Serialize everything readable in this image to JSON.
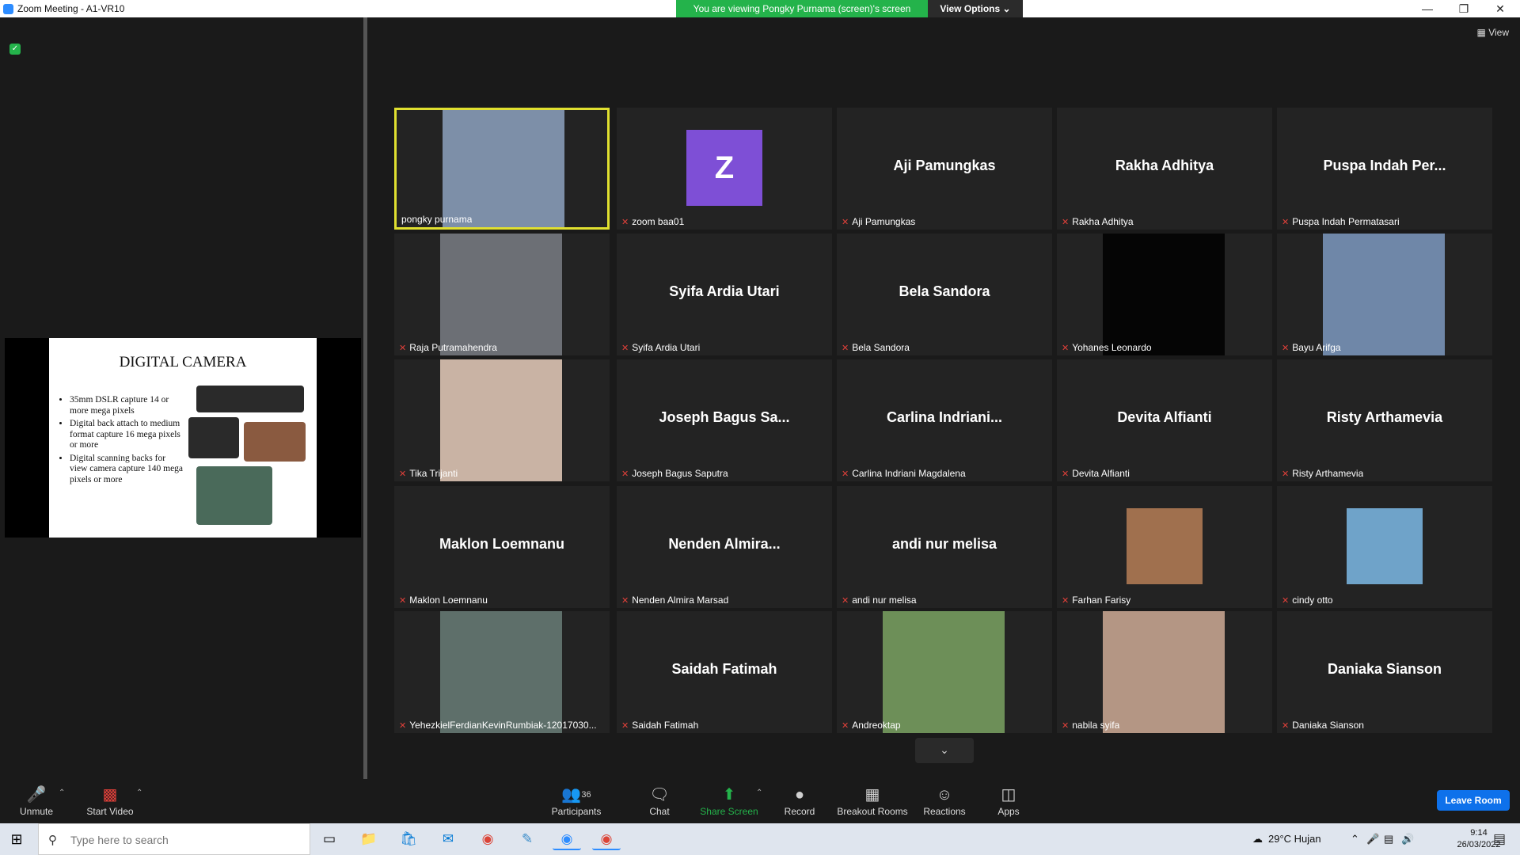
{
  "window": {
    "title": "Zoom Meeting - A1-VR10",
    "banner": "You are viewing Pongky Purnama (screen)'s screen",
    "view_options": "View Options",
    "view_button": "View"
  },
  "slide": {
    "title": "DIGITAL CAMERA",
    "bullets": [
      "35mm DSLR capture 14 or more mega pixels",
      "Digital back attach to medium format capture 16 mega pixels or more",
      "Digital scanning backs for view camera capture 140 mega pixels or more"
    ]
  },
  "participants": [
    {
      "label": "pongky purnama",
      "big": "",
      "type": "photo",
      "color": "#7d8fa8",
      "muted": false,
      "active": true
    },
    {
      "label": "zoom baa01",
      "big": "Z",
      "type": "avatar",
      "color": "#7e4fd6",
      "muted": true
    },
    {
      "label": "Aji Pamungkas",
      "big": "Aji Pamungkas",
      "type": "name",
      "muted": true
    },
    {
      "label": "Rakha Adhitya",
      "big": "Rakha Adhitya",
      "type": "name",
      "muted": true
    },
    {
      "label": "Puspa Indah Permatasari",
      "big": "Puspa Indah Per...",
      "type": "name",
      "muted": true
    },
    {
      "label": "Raja Putramahendra",
      "big": "",
      "type": "photo",
      "color": "#6c6f75",
      "muted": true
    },
    {
      "label": "Syifa Ardia Utari",
      "big": "Syifa Ardia Utari",
      "type": "name",
      "muted": true
    },
    {
      "label": "Bela Sandora",
      "big": "Bela Sandora",
      "type": "name",
      "muted": true
    },
    {
      "label": "Yohanes Leonardo",
      "big": "",
      "type": "photo",
      "color": "#050505",
      "muted": true
    },
    {
      "label": "Bayu Arifga",
      "big": "",
      "type": "photo",
      "color": "#6f87a8",
      "muted": true
    },
    {
      "label": "Tika Trijanti",
      "big": "",
      "type": "photo",
      "color": "#c9b3a4",
      "muted": true
    },
    {
      "label": "Joseph Bagus Saputra",
      "big": "Joseph Bagus Sa...",
      "type": "name",
      "muted": true
    },
    {
      "label": "Carlina Indriani Magdalena",
      "big": "Carlina  Indriani...",
      "type": "name",
      "muted": true
    },
    {
      "label": "Devita Alfianti",
      "big": "Devita Alfianti",
      "type": "name",
      "muted": true
    },
    {
      "label": "Risty Arthamevia",
      "big": "Risty Arthamevia",
      "type": "name",
      "muted": true
    },
    {
      "label": "Maklon Loemnanu",
      "big": "Maklon Loemnanu",
      "type": "name",
      "muted": true
    },
    {
      "label": "Nenden Almira Marsad",
      "big": "Nenden  Almira...",
      "type": "name",
      "muted": true
    },
    {
      "label": "andi nur melisa",
      "big": "andi nur melisa",
      "type": "name",
      "muted": true
    },
    {
      "label": "Farhan Farisy",
      "big": "",
      "type": "small-photo",
      "color": "#a0704e",
      "muted": true
    },
    {
      "label": "cindy otto",
      "big": "",
      "type": "small-photo",
      "color": "#6fa3c9",
      "muted": true
    },
    {
      "label": "YehezkielFerdianKevinRumbiak-12017030...",
      "big": "",
      "type": "photo",
      "color": "#5e6f6a",
      "muted": true
    },
    {
      "label": "Saidah Fatimah",
      "big": "Saidah Fatimah",
      "type": "name",
      "muted": true
    },
    {
      "label": "Andreoktap",
      "big": "",
      "type": "photo",
      "color": "#6d8f58",
      "muted": true
    },
    {
      "label": "nabila syifa",
      "big": "",
      "type": "photo",
      "color": "#b49684",
      "muted": true
    },
    {
      "label": "Daniaka Sianson",
      "big": "Daniaka Sianson",
      "type": "name",
      "muted": true
    }
  ],
  "toolbar": {
    "unmute": "Unmute",
    "start_video": "Start Video",
    "participants": "Participants",
    "participants_count": "36",
    "chat": "Chat",
    "share_screen": "Share Screen",
    "record": "Record",
    "breakout_rooms": "Breakout Rooms",
    "reactions": "Reactions",
    "apps": "Apps",
    "leave_room": "Leave Room"
  },
  "taskbar": {
    "search_placeholder": "Type here to search",
    "weather": "29°C  Hujan",
    "time": "9:14",
    "date": "26/03/2022"
  },
  "colors": {
    "banner_green": "#24b34b",
    "active_speaker_border": "#e0e030",
    "leave_blue": "#0e71eb",
    "mute_red": "#e0403a"
  }
}
